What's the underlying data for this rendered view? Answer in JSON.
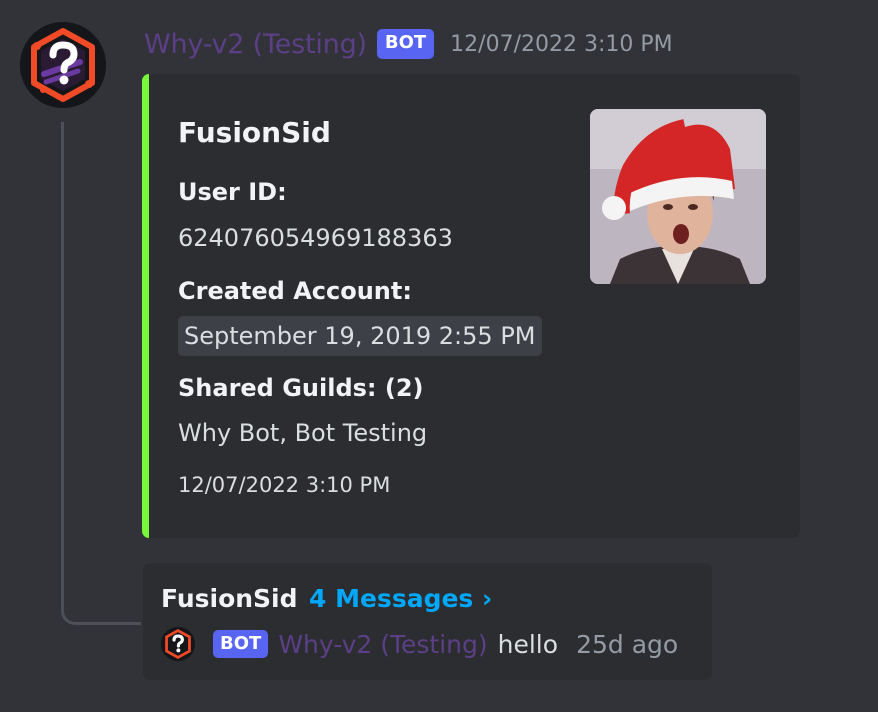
{
  "message": {
    "author": "Why-v2 (Testing)",
    "bot_tag": "BOT",
    "timestamp": "12/07/2022 3:10 PM",
    "avatar_icon": "question-mark-hex-icon"
  },
  "embed": {
    "accent_color": "#79f53a",
    "title": "FusionSid",
    "fields": [
      {
        "name": "User ID:",
        "value": "624076054969188363"
      },
      {
        "name": "Created Account:",
        "value": "September 19, 2019 2:55 PM"
      },
      {
        "name": "Shared Guilds: (2)",
        "value": "Why Bot, Bot Testing"
      }
    ],
    "footer": "12/07/2022 3:10 PM",
    "thumbnail": "user-avatar-santa-hat"
  },
  "thread": {
    "name": "FusionSid",
    "count": "4 Messages ›",
    "latest": {
      "bot_tag": "BOT",
      "author": "Why-v2 (Testing)",
      "text": "hello",
      "time": "25d ago"
    }
  },
  "colors": {
    "background": "#313338",
    "embed_bg": "#2b2d31",
    "bot_tag": "#5865f2",
    "author": "#5c3f86",
    "link": "#00a8fc"
  }
}
